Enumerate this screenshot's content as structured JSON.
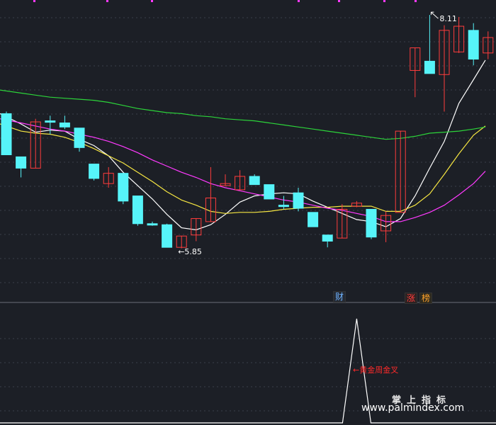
{
  "chart_data": [
    {
      "type": "candlestick",
      "panel": "main",
      "ylim": [
        5.5,
        8.2
      ],
      "grid": true,
      "colors": {
        "up": "#ff3c3c",
        "down": "#56f4f9",
        "ma_white": "#ffffff",
        "ma_yellow": "#f6e642",
        "ma_magenta": "#ff3aff",
        "ma_green": "#2cd43a"
      },
      "candles": [
        {
          "o": 7.15,
          "c": 6.75,
          "h": 7.17,
          "l": 6.75
        },
        {
          "o": 6.73,
          "c": 6.62,
          "h": 6.73,
          "l": 6.53
        },
        {
          "o": 6.62,
          "c": 7.07,
          "h": 7.1,
          "l": 6.62
        },
        {
          "o": 7.08,
          "c": 7.08,
          "h": 7.13,
          "l": 6.95
        },
        {
          "o": 7.06,
          "c": 7.02,
          "h": 7.13,
          "l": 7.0
        },
        {
          "o": 7.01,
          "c": 6.82,
          "h": 7.01,
          "l": 6.78
        },
        {
          "o": 6.66,
          "c": 6.52,
          "h": 6.66,
          "l": 6.5
        },
        {
          "o": 6.47,
          "c": 6.57,
          "h": 6.63,
          "l": 6.43
        },
        {
          "o": 6.57,
          "c": 6.3,
          "h": 6.57,
          "l": 6.27
        },
        {
          "o": 6.35,
          "c": 6.08,
          "h": 6.35,
          "l": 6.06
        },
        {
          "o": 6.08,
          "c": 6.08,
          "h": 6.1,
          "l": 6.06
        },
        {
          "o": 6.07,
          "c": 5.85,
          "h": 6.08,
          "l": 5.85
        },
        {
          "o": 5.85,
          "c": 5.96,
          "h": 5.96,
          "l": 5.84
        },
        {
          "o": 5.97,
          "c": 6.13,
          "h": 6.13,
          "l": 5.91
        },
        {
          "o": 6.1,
          "c": 6.33,
          "h": 6.63,
          "l": 6.1
        },
        {
          "o": 6.45,
          "c": 6.47,
          "h": 6.56,
          "l": 6.45
        },
        {
          "o": 6.41,
          "c": 6.54,
          "h": 6.6,
          "l": 6.41
        },
        {
          "o": 6.54,
          "c": 6.46,
          "h": 6.56,
          "l": 6.46
        },
        {
          "o": 6.46,
          "c": 6.32,
          "h": 6.46,
          "l": 6.32
        },
        {
          "o": 6.26,
          "c": 6.26,
          "h": 6.35,
          "l": 6.22
        },
        {
          "o": 6.38,
          "c": 6.23,
          "h": 6.43,
          "l": 6.2
        },
        {
          "o": 6.19,
          "c": 6.05,
          "h": 6.19,
          "l": 6.05
        },
        {
          "o": 5.97,
          "c": 5.91,
          "h": 5.97,
          "l": 5.85
        },
        {
          "o": 5.94,
          "c": 6.22,
          "h": 6.27,
          "l": 5.94
        },
        {
          "o": 6.25,
          "c": 6.28,
          "h": 6.3,
          "l": 6.24
        },
        {
          "o": 6.22,
          "c": 5.95,
          "h": 6.22,
          "l": 5.93
        },
        {
          "o": 6.01,
          "c": 6.16,
          "h": 6.2,
          "l": 5.9
        },
        {
          "o": 6.19,
          "c": 6.98,
          "h": 6.98,
          "l": 6.19
        },
        {
          "o": 7.57,
          "c": 7.79,
          "h": 7.79,
          "l": 7.31
        },
        {
          "o": 7.66,
          "c": 7.54,
          "h": 8.11,
          "l": 7.54
        },
        {
          "o": 7.53,
          "c": 7.96,
          "h": 8.01,
          "l": 7.17
        },
        {
          "o": 7.75,
          "c": 8.0,
          "h": 8.09,
          "l": 7.74
        },
        {
          "o": 7.96,
          "c": 7.68,
          "h": 8.03,
          "l": 7.62
        },
        {
          "o": 7.74,
          "c": 7.89,
          "h": 7.95,
          "l": 7.68
        }
      ],
      "ma_lines": [
        {
          "color": "white",
          "values": [
            7.15,
            7.05,
            6.97,
            6.99,
            6.98,
            6.9,
            6.84,
            6.74,
            6.58,
            6.45,
            6.32,
            6.17,
            6.04,
            6.02,
            6.07,
            6.17,
            6.29,
            6.35,
            6.37,
            6.38,
            6.37,
            6.3,
            6.24,
            6.18,
            6.12,
            6.1,
            6.05,
            6.13,
            6.35,
            6.62,
            6.88,
            7.25,
            7.48,
            7.67
          ]
        },
        {
          "color": "yellow",
          "values": [
            7.05,
            6.98,
            6.96,
            6.95,
            6.92,
            6.87,
            6.81,
            6.74,
            6.67,
            6.58,
            6.49,
            6.39,
            6.31,
            6.26,
            6.2,
            6.18,
            6.19,
            6.19,
            6.2,
            6.22,
            6.23,
            6.24,
            6.24,
            6.25,
            6.25,
            6.25,
            6.2,
            6.2,
            6.26,
            6.37,
            6.56,
            6.76,
            6.94,
            7.03
          ]
        },
        {
          "color": "magenta",
          "values": [
            7.1,
            7.06,
            7.03,
            7.0,
            6.98,
            6.95,
            6.92,
            6.88,
            6.83,
            6.77,
            6.7,
            6.64,
            6.58,
            6.53,
            6.47,
            6.43,
            6.4,
            6.37,
            6.34,
            6.31,
            6.29,
            6.26,
            6.23,
            6.21,
            6.18,
            6.15,
            6.1,
            6.1,
            6.14,
            6.19,
            6.26,
            6.36,
            6.47,
            6.59
          ]
        },
        {
          "color": "green",
          "values": [
            7.38,
            7.35,
            7.33,
            7.31,
            7.3,
            7.29,
            7.28,
            7.26,
            7.23,
            7.2,
            7.18,
            7.16,
            7.15,
            7.13,
            7.12,
            7.1,
            7.09,
            7.08,
            7.06,
            7.04,
            7.02,
            7.0,
            6.98,
            6.96,
            6.94,
            6.92,
            6.9,
            6.91,
            6.93,
            6.96,
            6.97,
            6.98,
            7.0,
            7.02
          ]
        }
      ],
      "annotations": [
        {
          "text": "←5.85",
          "at_index": 12,
          "value": 5.85
        },
        {
          "text": "8.11",
          "at_index": 29,
          "value": 8.11
        }
      ],
      "markers": [
        {
          "text": "财",
          "at_index": 23
        },
        {
          "text": "涨",
          "at_index": 28
        },
        {
          "text": "榜",
          "at_index": 29
        }
      ]
    },
    {
      "type": "line",
      "panel": "indicator",
      "ylim": [
        0,
        1
      ],
      "values": [
        0,
        0,
        0,
        0,
        0,
        0,
        0,
        0,
        0,
        0,
        0,
        0,
        0,
        0,
        0,
        0,
        0,
        0,
        0,
        0,
        0,
        0,
        0,
        0,
        1,
        0,
        0,
        0,
        0,
        0,
        0,
        0,
        0,
        0
      ],
      "annotation": "←黄金周金叉"
    }
  ],
  "labels": {
    "low": "←5.85",
    "high": "8.11",
    "tag_cai": "财",
    "tag_zhang": "涨",
    "tag_bang": "榜",
    "signal": "←黄金周金叉",
    "watermark_title": "掌上指标",
    "watermark_url": "www.palmindex.com"
  }
}
